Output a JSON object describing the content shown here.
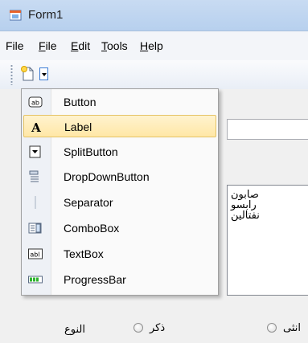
{
  "window": {
    "title": "Form1"
  },
  "menubar": {
    "items": [
      {
        "label": "File",
        "mnemonic": ""
      },
      {
        "label": "File",
        "mnemonic": "F"
      },
      {
        "label": "Edit",
        "mnemonic": "E"
      },
      {
        "label": "Tools",
        "mnemonic": "T"
      },
      {
        "label": "Help",
        "mnemonic": "H"
      }
    ]
  },
  "dropdown": {
    "items": [
      {
        "label": "Button",
        "icon": "button-icon"
      },
      {
        "label": "Label",
        "icon": "label-icon",
        "highlighted": true
      },
      {
        "label": "SplitButton",
        "icon": "split-button-icon"
      },
      {
        "label": "DropDownButton",
        "icon": "dropdown-button-icon"
      },
      {
        "label": "Separator",
        "icon": "separator-icon"
      },
      {
        "label": "ComboBox",
        "icon": "combobox-icon"
      },
      {
        "label": "TextBox",
        "icon": "textbox-icon"
      },
      {
        "label": "ProgressBar",
        "icon": "progressbar-icon"
      }
    ]
  },
  "listbox": {
    "items": [
      "صابون",
      "رابسو",
      "نفتالين"
    ]
  },
  "gender": {
    "label": "النوع",
    "options": [
      {
        "label": "ذكر",
        "checked": false
      },
      {
        "label": "انثى",
        "checked": false
      }
    ]
  },
  "colors": {
    "highlight": "#ffe7a6",
    "titlebar": "#c8dbf2"
  }
}
